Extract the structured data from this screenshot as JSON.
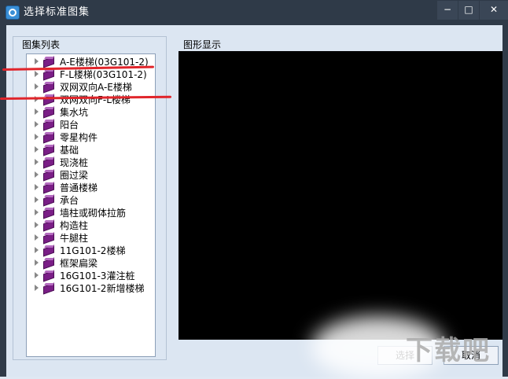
{
  "window": {
    "title": "选择标准图集",
    "controls": {
      "minimize": "−",
      "maximize": "□",
      "close": "✕"
    }
  },
  "left_panel": {
    "label": "图集列表",
    "items": [
      {
        "label": "A-E楼梯(03G101-2)"
      },
      {
        "label": "F-L楼梯(03G101-2)"
      },
      {
        "label": "双网双向A-E楼梯"
      },
      {
        "label": "双网双向F-L楼梯"
      },
      {
        "label": "集水坑"
      },
      {
        "label": "阳台"
      },
      {
        "label": "零星构件"
      },
      {
        "label": "基础"
      },
      {
        "label": "现浇桩"
      },
      {
        "label": "圈过梁"
      },
      {
        "label": "普通楼梯"
      },
      {
        "label": "承台"
      },
      {
        "label": "墙柱或砌体拉筋"
      },
      {
        "label": "构造柱"
      },
      {
        "label": "牛腿柱"
      },
      {
        "label": "11G101-2楼梯"
      },
      {
        "label": "框架扁梁"
      },
      {
        "label": "16G101-3灌注桩"
      },
      {
        "label": "16G101-2新增楼梯"
      }
    ]
  },
  "right_panel": {
    "label": "图形显示"
  },
  "buttons": {
    "select": "选择",
    "cancel": "取消"
  },
  "watermark": {
    "text": "下载吧"
  },
  "icons": {
    "app": "app-logo-icon",
    "tree_item": "book-icon",
    "expander": "expand-arrow-icon"
  },
  "colors": {
    "title_bar": "#2f3a48",
    "client_bg": "#dce6f2",
    "preview_bg": "#000000",
    "book": "#7a1e86",
    "annotation": "#e0252b"
  }
}
